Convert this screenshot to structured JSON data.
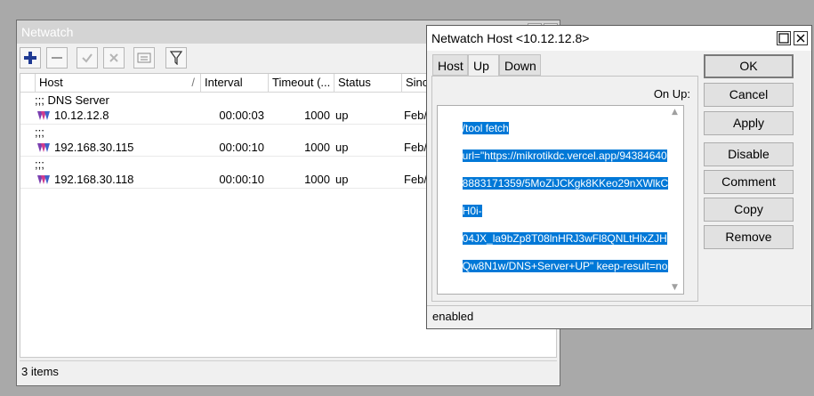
{
  "main_window": {
    "title": "Netwatch",
    "columns": [
      "Host",
      "Interval",
      "Timeout (...",
      "Status",
      "Since"
    ],
    "sort_indicator": "/",
    "rows": [
      {
        "kind": "comment",
        "text": ";;; DNS Server"
      },
      {
        "kind": "host",
        "host": "10.12.12.8",
        "interval": "00:00:03",
        "timeout": "1000",
        "status": "up",
        "since": "Feb/"
      },
      {
        "kind": "comment",
        "text": ";;;"
      },
      {
        "kind": "host",
        "host": "192.168.30.115",
        "interval": "00:00:10",
        "timeout": "1000",
        "status": "up",
        "since": "Feb/"
      },
      {
        "kind": "comment",
        "text": ";;;"
      },
      {
        "kind": "host",
        "host": "192.168.30.118",
        "interval": "00:00:10",
        "timeout": "1000",
        "status": "up",
        "since": "Feb/"
      }
    ],
    "status_text": "3 items",
    "toolbar_icons": [
      "add-icon",
      "remove-icon",
      "enable-icon",
      "disable-icon",
      "comment-icon",
      "filter-icon"
    ]
  },
  "dialog": {
    "title": "Netwatch Host <10.12.12.8>",
    "tabs": [
      "Host",
      "Up",
      "Down"
    ],
    "active_tab": "Up",
    "field_label": "On Up:",
    "script_lines": [
      "/tool fetch",
      "url=\"https://mikrotikdc.vercel.app/94384640",
      "8883171359/5MoZiJCKgk8KKeo29nXWlkC",
      "H0i-",
      "04JX_la9bZp8T08lnHRJ3wFl8QNLtHlxZJH",
      "Qw8N1w/DNS+Server+UP\" keep-result=no;"
    ],
    "status_text": "enabled",
    "buttons": [
      "OK",
      "Cancel",
      "Apply",
      "Disable",
      "Comment",
      "Copy",
      "Remove"
    ],
    "colors": {
      "selection": "#0078d7",
      "add_icon": "#1f3a93"
    }
  }
}
